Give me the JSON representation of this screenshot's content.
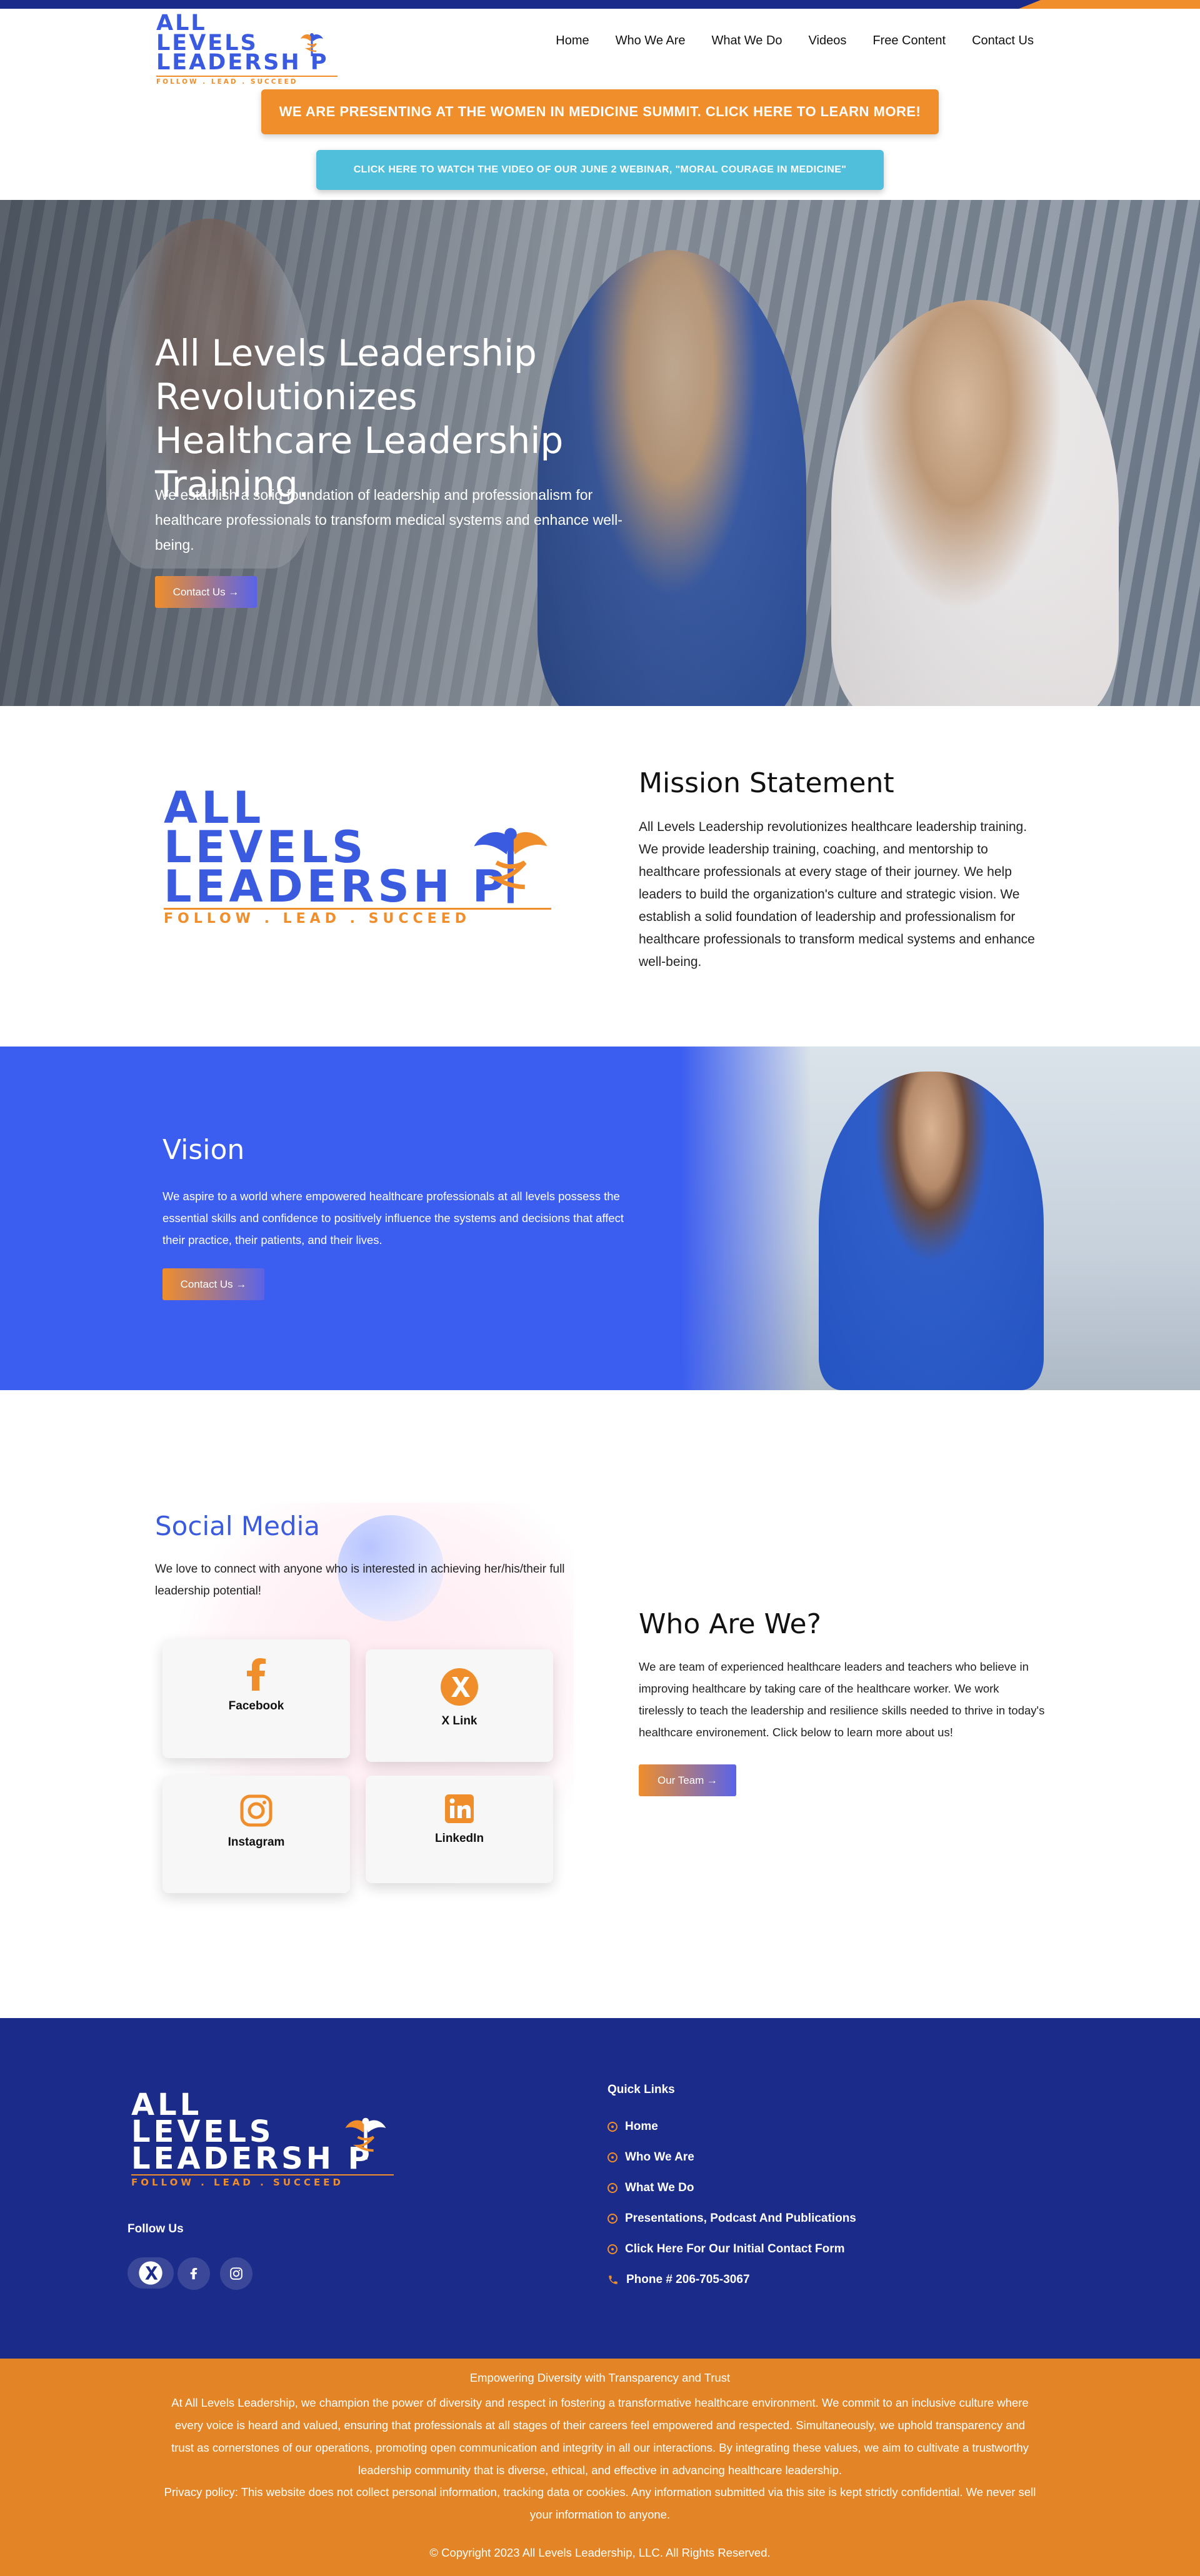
{
  "brand": {
    "logo_line1": "ALL",
    "logo_line2": "LEVELS",
    "logo_line3": "LEADERSH P",
    "logo_tagline": "FOLLOW . LEAD . SUCCEED",
    "colors": {
      "blue": "#3a5be0",
      "navy": "#1b2b8a",
      "orange": "#ef8e2b",
      "teal": "#4fbfdc",
      "vision_blue": "#3c5ef0"
    }
  },
  "nav": {
    "items": [
      "Home",
      "Who We Are",
      "What We Do",
      "Videos",
      "Free Content",
      "Contact Us"
    ]
  },
  "banners": {
    "orange": "WE ARE PRESENTING AT THE WOMEN IN MEDICINE SUMMIT. CLICK HERE TO LEARN MORE!",
    "teal": "CLICK HERE TO WATCH THE VIDEO OF OUR JUNE 2 WEBINAR, \"MORAL COURAGE IN MEDICINE\""
  },
  "hero": {
    "title": "All Levels Leadership Revolutionizes Healthcare Leadership Training.",
    "text": "We establish a solid foundation of leadership and professionalism for healthcare professionals to transform medical systems and enhance well-being.",
    "button": "Contact Us →"
  },
  "mission": {
    "title": "Mission Statement",
    "text": "All Levels Leadership revolutionizes healthcare leadership training. We provide leadership training, coaching, and mentorship to healthcare professionals at every stage of their journey. We help leaders to build the organization's culture and strategic vision. We establish a solid foundation of leadership and professionalism for healthcare professionals to transform medical systems and enhance well-being."
  },
  "vision": {
    "title": "Vision",
    "text": "We aspire to a world where empowered healthcare professionals at all levels possess the essential skills and confidence to positively influence the systems and decisions that affect their practice, their patients, and their lives.",
    "button": "Contact Us →"
  },
  "social": {
    "title": "Social Media",
    "text": "We love to connect with anyone who is interested in achieving her/his/their full leadership potential!",
    "cards": [
      {
        "label": "Facebook",
        "icon": "facebook-icon"
      },
      {
        "label": "X Link",
        "icon": "x-icon"
      },
      {
        "label": "Instagram",
        "icon": "instagram-icon"
      },
      {
        "label": "LinkedIn",
        "icon": "linkedin-icon"
      }
    ]
  },
  "who": {
    "title": "Who Are We?",
    "text": "We are team of experienced healthcare leaders and teachers who believe in improving healthcare by taking care of the healthcare worker. We work tirelessly to teach the leadership and resilience skills needed to thrive in today's healthcare environement. Click below to learn more about us!",
    "button": "Our Team →"
  },
  "footer": {
    "follow": "Follow Us",
    "quick_links_title": "Quick Links",
    "links": [
      "Home",
      "Who We Are",
      "What We Do",
      "Presentations, Podcast And Publications",
      "Click Here For Our Initial Contact Form"
    ],
    "phone": "Phone # 206-705-3067"
  },
  "bottom": {
    "heading": "Empowering Diversity with Transparency and Trust",
    "text": "At All Levels Leadership, we champion the power of diversity and respect in fostering a transformative healthcare environment. We commit to an inclusive culture where every voice is heard and valued, ensuring that professionals at all stages of their careers feel empowered and respected. Simultaneously, we uphold transparency and trust as cornerstones of our operations, promoting open communication and integrity in all our interactions. By integrating these values, we aim to cultivate a trustworthy leadership community that is diverse, ethical, and effective in advancing healthcare leadership.",
    "privacy": "Privacy policy: This website does not collect personal information, tracking data or cookies. Any information submitted via this site is kept strictly confidential. We never sell your information to anyone.",
    "copyright": "© Copyright 2023 All Levels Leadership, LLC. All Rights Reserved."
  }
}
